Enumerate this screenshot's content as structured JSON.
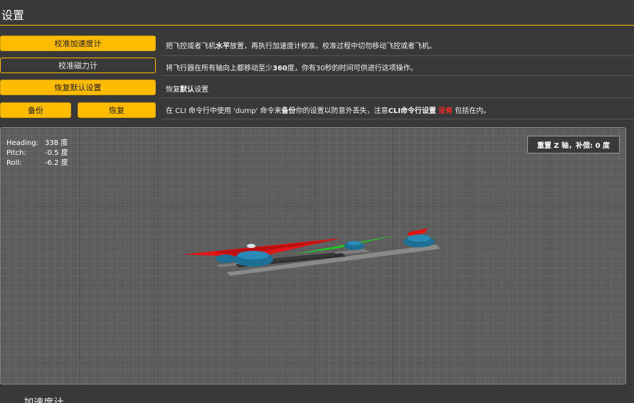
{
  "header": {
    "title": "设置"
  },
  "rows": [
    {
      "button": "校准加速度计",
      "desc": [
        {
          "t": "把飞控或者飞机"
        },
        {
          "t": "水平",
          "b": true
        },
        {
          "t": "放置，再执行加速度计校准。校准过程中切勿移动飞控或者飞机。"
        }
      ]
    },
    {
      "button": "校准磁力计",
      "desc": [
        {
          "t": "将飞行器在所有轴向上都移动至少"
        },
        {
          "t": "360",
          "b": true
        },
        {
          "t": "度，你有30秒的时间可供进行这项操作。"
        }
      ]
    },
    {
      "button": "恢复默认设置",
      "desc": [
        {
          "t": "恢复"
        },
        {
          "t": "默认",
          "b": true
        },
        {
          "t": "设置"
        }
      ]
    },
    {
      "buttons": [
        "备份",
        "恢复"
      ],
      "desc": [
        {
          "t": "在 CLI 命令行中使用 'dump' 命令来"
        },
        {
          "t": "备份",
          "b": true
        },
        {
          "t": "你的设置以防意外丢失，注意"
        },
        {
          "t": "CLI命令行设置",
          "b": true
        },
        {
          "t": " "
        },
        {
          "t": "没有",
          "red": true
        },
        {
          "t": " 包括在内。"
        }
      ]
    }
  ],
  "attitude": {
    "heading_label": "Heading:",
    "heading_value": "338 度",
    "pitch_label": "Pitch:",
    "pitch_value": "-0.5 度",
    "roll_label": "Roll:",
    "roll_value": "-6.2 度"
  },
  "reset_button": "重置 Z 轴，补偿: 0 度",
  "footer": "...加速度计..."
}
